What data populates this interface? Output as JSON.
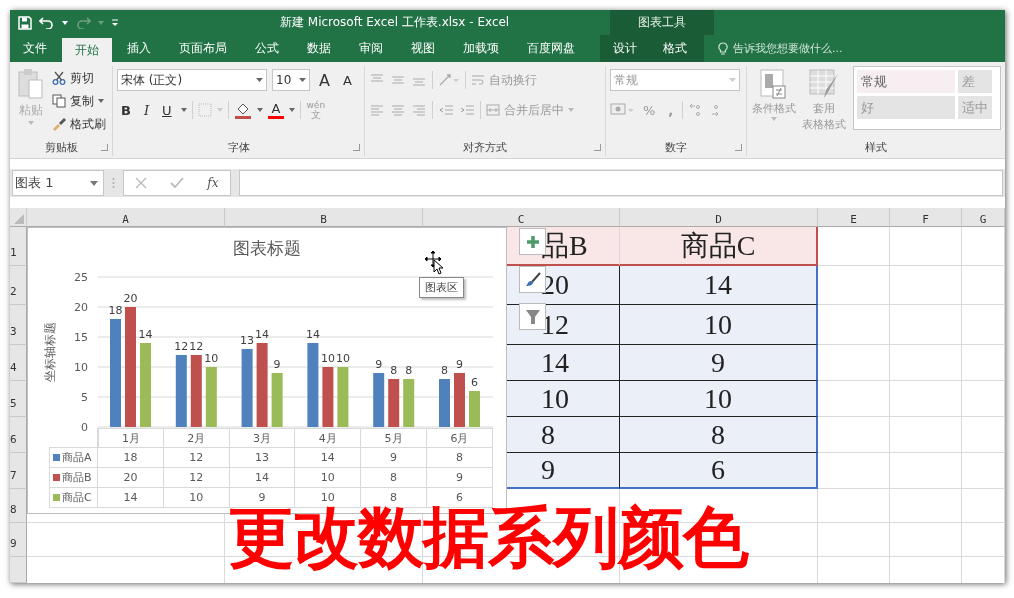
{
  "window": {
    "title": "新建 Microsoft Excel 工作表.xlsx - Excel",
    "context_group": "图表工具"
  },
  "tabs": [
    {
      "label": "文件",
      "selected": false,
      "kind": "main"
    },
    {
      "label": "开始",
      "selected": true,
      "kind": "main"
    },
    {
      "label": "插入",
      "selected": false,
      "kind": "main"
    },
    {
      "label": "页面布局",
      "selected": false,
      "kind": "main"
    },
    {
      "label": "公式",
      "selected": false,
      "kind": "main"
    },
    {
      "label": "数据",
      "selected": false,
      "kind": "main"
    },
    {
      "label": "审阅",
      "selected": false,
      "kind": "main"
    },
    {
      "label": "视图",
      "selected": false,
      "kind": "main"
    },
    {
      "label": "加载项",
      "selected": false,
      "kind": "main"
    },
    {
      "label": "百度网盘",
      "selected": false,
      "kind": "main"
    },
    {
      "label": "设计",
      "selected": false,
      "kind": "context"
    },
    {
      "label": "格式",
      "selected": false,
      "kind": "context"
    }
  ],
  "tell_me": {
    "placeholder": "告诉我您想要做什么..."
  },
  "clipboard": {
    "paste": "粘贴",
    "paste_disabled": true,
    "cut": "剪切",
    "copy": "复制",
    "painter": "格式刷",
    "group": "剪贴板"
  },
  "font": {
    "name": "宋体 (正文)",
    "size": "10",
    "grow": "A",
    "shrink": "A",
    "bold": "B",
    "italic": "I",
    "underline": "U",
    "color_letter": "A",
    "phonetic_top": "wén",
    "phonetic_bottom": "文",
    "group": "字体"
  },
  "alignment": {
    "wrap": "自动换行",
    "merge": "合并后居中",
    "group": "对齐方式"
  },
  "number": {
    "format": "常规",
    "percent": "%",
    "comma": ",",
    "group": "数字"
  },
  "styles": {
    "conditional": "条件格式",
    "table_format_top": "套用",
    "table_format_bottom": "表格格式",
    "group": "样式",
    "gallery": [
      {
        "label": "常规",
        "kind": "normal",
        "selected": true
      },
      {
        "label": "差",
        "kind": "bad",
        "selected": false
      },
      {
        "label": "好",
        "kind": "good",
        "selected": false
      },
      {
        "label": "适中",
        "kind": "neutral",
        "selected": false
      }
    ]
  },
  "formula_bar": {
    "name_box": "图表 1",
    "fx": "fx"
  },
  "sheet": {
    "columns": [
      "A",
      "B",
      "C",
      "D",
      "E",
      "F",
      "G"
    ],
    "rows": [
      "1",
      "2",
      "3",
      "4",
      "5",
      "6",
      "7",
      "8",
      "9"
    ],
    "table": {
      "header": [
        "品B",
        "商品C"
      ],
      "rows": [
        [
          "20",
          "14"
        ],
        [
          "12",
          "10"
        ],
        [
          "14",
          "9"
        ],
        [
          "10",
          "10"
        ],
        [
          "8",
          "8"
        ],
        [
          "9",
          "6"
        ]
      ]
    }
  },
  "chart": {
    "tooltip": "图表区",
    "chart_data": {
      "type": "bar",
      "title": "图表标题",
      "ylabel": "坐标轴标题",
      "categories": [
        "1月",
        "2月",
        "3月",
        "4月",
        "5月",
        "6月"
      ],
      "series": [
        {
          "name": "商品A",
          "color": "#4f81bd",
          "values": [
            18,
            12,
            13,
            14,
            9,
            8
          ]
        },
        {
          "name": "商品B",
          "color": "#c0504d",
          "values": [
            20,
            12,
            14,
            10,
            8,
            9
          ]
        },
        {
          "name": "商品C",
          "color": "#9bbb59",
          "values": [
            14,
            10,
            9,
            10,
            8,
            6
          ]
        }
      ],
      "ylim": [
        0,
        25
      ],
      "yticks": [
        0,
        5,
        10,
        15,
        20,
        25
      ],
      "grid": true,
      "legend": "bottom_left",
      "data_labels": true
    },
    "data_labels": [
      [
        "18",
        "12",
        "13",
        "14",
        "9",
        "8"
      ],
      [
        "20",
        "12",
        "14",
        "10",
        "8",
        "9"
      ],
      [
        "14",
        "10",
        "9",
        "10",
        "8",
        "6"
      ]
    ],
    "data_table": [
      [
        "18",
        "12",
        "13",
        "14",
        "9",
        "8"
      ],
      [
        "20",
        "12",
        "14",
        "10",
        "8",
        "9"
      ],
      [
        "14",
        "10",
        "9",
        "10",
        "8",
        "6"
      ]
    ]
  },
  "caption": "更改数据系列颜色"
}
